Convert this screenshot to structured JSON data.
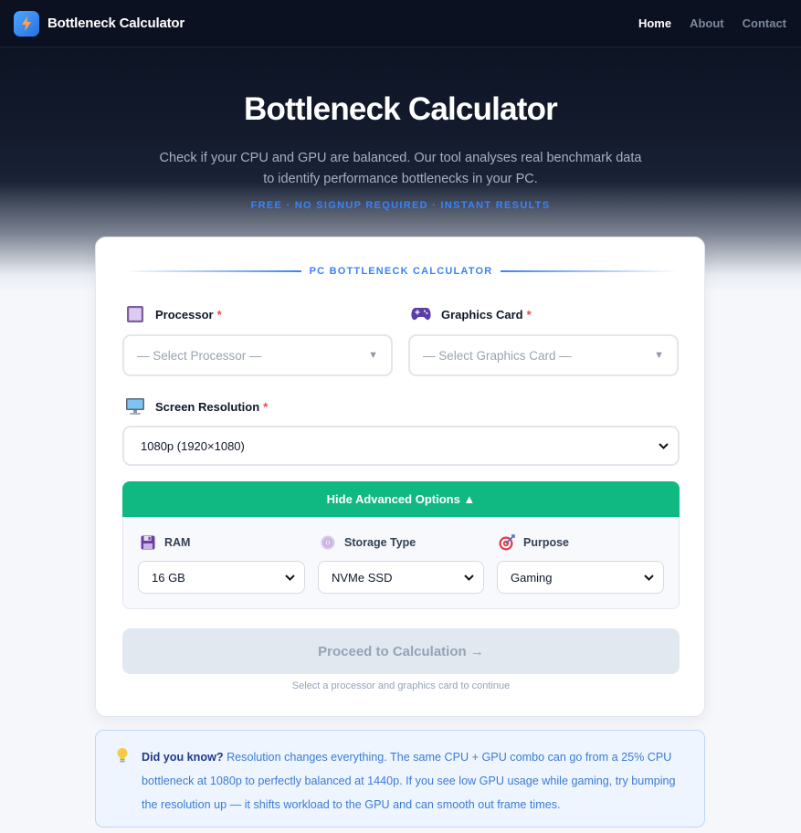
{
  "nav": {
    "brand": "Bottleneck Calculator",
    "links": [
      "Home",
      "About",
      "Contact"
    ],
    "active_link": "Home"
  },
  "hero": {
    "title": "Bottleneck Calculator",
    "subtitle_line1": "Check if your CPU and GPU are balanced. Our tool analyses real benchmark data",
    "subtitle_line2": "to identify performance bottlenecks in your PC.",
    "tagline": "FREE · NO SIGNUP REQUIRED · INSTANT RESULTS"
  },
  "calculator": {
    "heading": "PC BOTTLENECK CALCULATOR",
    "processor": {
      "label": "Processor",
      "required_mark": "*",
      "placeholder": "— Select Processor —",
      "icon": "processor-icon"
    },
    "graphics": {
      "label": "Graphics Card",
      "required_mark": "*",
      "placeholder": "— Select Graphics Card —",
      "icon": "gamepad-icon"
    },
    "resolution": {
      "label": "Screen Resolution",
      "required_mark": "*",
      "value": "1080p (1920×1080)",
      "icon": "monitor-icon"
    },
    "advanced_toggle": "Hide Advanced Options ▲",
    "advanced": {
      "ram": {
        "label": "RAM",
        "value": "16 GB",
        "icon": "floppy-disk-icon"
      },
      "storage": {
        "label": "Storage Type",
        "value": "NVMe SSD",
        "icon": "disc-icon"
      },
      "purpose": {
        "label": "Purpose",
        "value": "Gaming",
        "icon": "target-icon"
      }
    },
    "proceed_label": "Proceed to Calculation →",
    "hint": "Select a processor and graphics card to continue"
  },
  "tip": {
    "lead": "Did you know?",
    "line1": "Resolution changes everything. The same CPU + GPU combo can go from a 25% CPU",
    "line2": "bottleneck at 1080p to perfectly balanced at 1440p. If you see low GPU usage while gaming, try bumping",
    "line3": "the resolution up — it shifts workload to the GPU and can smooth out frame times.",
    "icon": "lightbulb-icon"
  },
  "colors": {
    "accent_blue": "#3b82f6",
    "toggle_green": "#10b981",
    "required_red": "#ef4444",
    "nav_bg": "#0b1120"
  }
}
